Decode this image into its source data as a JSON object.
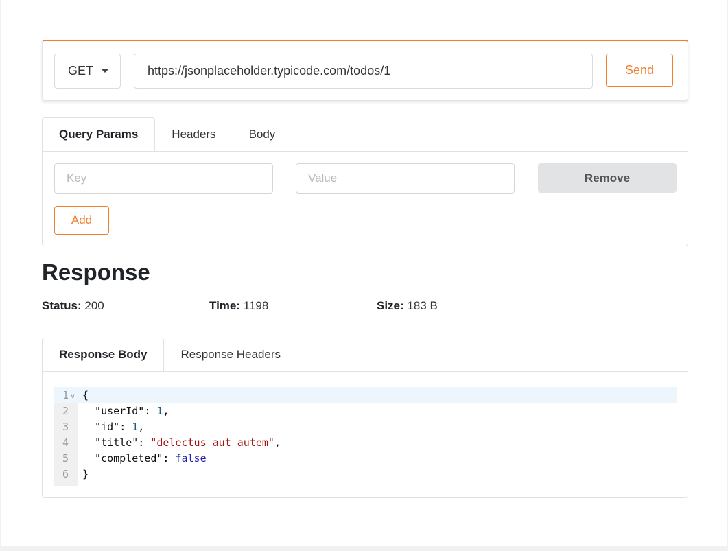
{
  "request": {
    "method": "GET",
    "url": "https://jsonplaceholder.typicode.com/todos/1",
    "send_label": "Send"
  },
  "param_tabs": [
    {
      "label": "Query Params",
      "active": true
    },
    {
      "label": "Headers",
      "active": false
    },
    {
      "label": "Body",
      "active": false
    }
  ],
  "query_params": {
    "key_placeholder": "Key",
    "value_placeholder": "Value",
    "remove_label": "Remove",
    "add_label": "Add"
  },
  "response": {
    "heading": "Response",
    "status_label": "Status:",
    "status_value": "200",
    "time_label": "Time:",
    "time_value": "1198",
    "size_label": "Size:",
    "size_value": "183 B",
    "tabs": [
      {
        "label": "Response Body",
        "active": true
      },
      {
        "label": "Response Headers",
        "active": false
      }
    ],
    "body_lines": [
      {
        "num": "1",
        "tokens": [
          {
            "t": "{",
            "k": "plain"
          }
        ]
      },
      {
        "num": "2",
        "tokens": [
          {
            "t": "  \"userId\"",
            "k": "key"
          },
          {
            "t": ": ",
            "k": "plain"
          },
          {
            "t": "1",
            "k": "num"
          },
          {
            "t": ",",
            "k": "plain"
          }
        ]
      },
      {
        "num": "3",
        "tokens": [
          {
            "t": "  \"id\"",
            "k": "key"
          },
          {
            "t": ": ",
            "k": "plain"
          },
          {
            "t": "1",
            "k": "num"
          },
          {
            "t": ",",
            "k": "plain"
          }
        ]
      },
      {
        "num": "4",
        "tokens": [
          {
            "t": "  \"title\"",
            "k": "key"
          },
          {
            "t": ": ",
            "k": "plain"
          },
          {
            "t": "\"delectus aut autem\"",
            "k": "str"
          },
          {
            "t": ",",
            "k": "plain"
          }
        ]
      },
      {
        "num": "5",
        "tokens": [
          {
            "t": "  \"completed\"",
            "k": "key"
          },
          {
            "t": ": ",
            "k": "plain"
          },
          {
            "t": "false",
            "k": "bool"
          }
        ]
      },
      {
        "num": "6",
        "tokens": [
          {
            "t": "}",
            "k": "plain"
          }
        ]
      }
    ]
  },
  "colors": {
    "accent": "#f07e2a",
    "string": "#a31515",
    "number": "#1e5e7e",
    "boolean": "#1e1eb4"
  },
  "icons": {
    "method_dropdown": "chevron-down-icon",
    "fold": "fold-arrow-icon"
  }
}
